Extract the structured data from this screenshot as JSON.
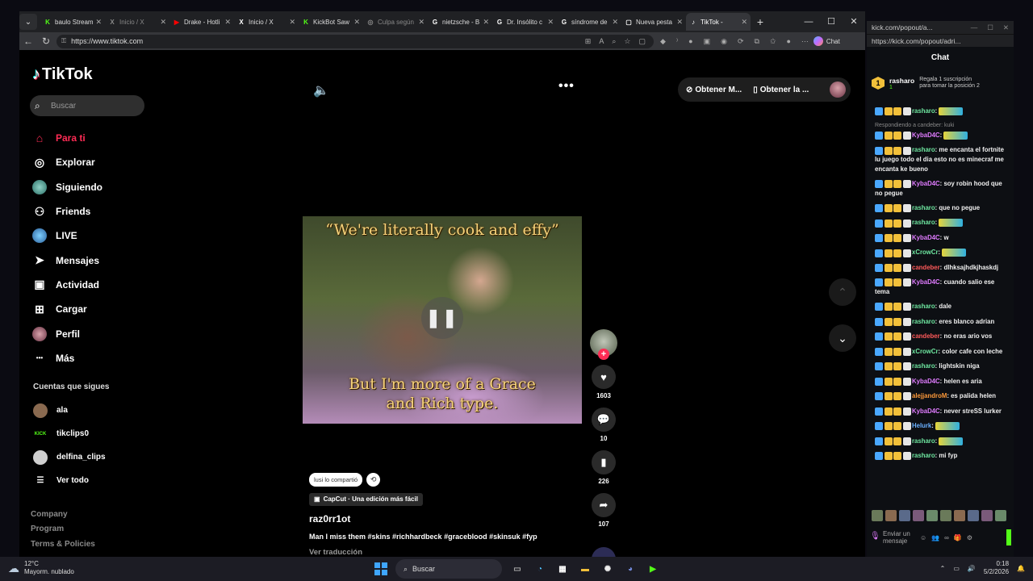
{
  "browser": {
    "tabs": [
      {
        "label": "baulo Stream",
        "icon": "kick-icon",
        "color": "#53fc18",
        "dim": false
      },
      {
        "label": "Inicio / X",
        "icon": "x-icon",
        "color": "#888888",
        "dim": true
      },
      {
        "label": "Drake - Hotli",
        "icon": "youtube-icon",
        "color": "#ff0000",
        "dim": false
      },
      {
        "label": "Inicio / X",
        "icon": "x-icon",
        "color": "#ffffff",
        "dim": false
      },
      {
        "label": "KickBot Saw",
        "icon": "kick-icon",
        "color": "#53fc18",
        "dim": false
      },
      {
        "label": "Culpa según",
        "icon": "globe-icon",
        "color": "#888888",
        "dim": true
      },
      {
        "label": "nietzsche - B",
        "icon": "google-icon",
        "color": "#ffffff",
        "dim": false
      },
      {
        "label": "Dr. Insólito c",
        "icon": "google-icon",
        "color": "#ffffff",
        "dim": false
      },
      {
        "label": "síndrome de",
        "icon": "google-icon",
        "color": "#ffffff",
        "dim": false
      },
      {
        "label": "Nueva pesta",
        "icon": "new-tab-icon",
        "color": "#ffffff",
        "dim": false
      },
      {
        "label": "TikTok -",
        "icon": "tiktok-icon",
        "color": "#ffffff",
        "dim": false,
        "active": true
      }
    ],
    "url": "https://www.tiktok.com",
    "chat_label": "Chat"
  },
  "tiktok": {
    "logo": "TikTok",
    "search_placeholder": "Buscar",
    "nav": [
      {
        "label": "Para ti",
        "icon": "home-icon",
        "active": true
      },
      {
        "label": "Explorar",
        "icon": "compass-icon"
      },
      {
        "label": "Siguiendo",
        "icon": "following-avatar-icon"
      },
      {
        "label": "Friends",
        "icon": "friends-icon"
      },
      {
        "label": "LIVE",
        "icon": "live-avatar-icon"
      },
      {
        "label": "Mensajes",
        "icon": "send-icon"
      },
      {
        "label": "Actividad",
        "icon": "activity-icon"
      },
      {
        "label": "Cargar",
        "icon": "upload-icon"
      },
      {
        "label": "Perfil",
        "icon": "profile-avatar-icon"
      },
      {
        "label": "Más",
        "icon": "more-icon"
      }
    ],
    "following_title": "Cuentas que sigues",
    "following": [
      {
        "name": "ala",
        "avatar_color": "#8a6a50",
        "badge": ""
      },
      {
        "name": "tikclips0",
        "avatar_color": "#000000",
        "badge": "KICK"
      },
      {
        "name": "delfina_clips",
        "avatar_color": "#cfcfcf",
        "badge": ""
      }
    ],
    "see_all": "Ver todo",
    "footer": [
      "Company",
      "Program",
      "Terms & Policies"
    ],
    "top_buttons": [
      "Obtener M...",
      "Obtener la ..."
    ],
    "video": {
      "caption_top": "“We're literally cook and effy”",
      "caption_bottom": "But I'm more of a Grace and Rich type.",
      "likes": "1603",
      "comments": "10",
      "saves": "226",
      "shares": "107",
      "shared_by": "lusi lo compartió",
      "capcut": "CapCut · Una edición más fácil",
      "username": "raz0rr1ot",
      "description": "Man I miss them #skins #richhardbeck #graceblood #skinsuk #fyp",
      "translate": "Ver traducción",
      "progress": 0.27
    }
  },
  "kick": {
    "title": "kick.com/popout/a...",
    "url": "https://kick.com/popout/adri...",
    "header": "Chat",
    "pinned": {
      "user": "rasharo",
      "count": "1",
      "text": "Regala 1 suscripción para tomar la posición 2"
    },
    "messages": [
      {
        "user": "rasharo",
        "color": "#6ee7a0",
        "text": "",
        "emote": true
      },
      {
        "reply": "Respondiendo a candeber: kuki",
        "user": "KybaD4C",
        "color": "#e07cff",
        "text": "",
        "emote": true
      },
      {
        "user": "rasharo",
        "color": "#6ee7a0",
        "text": "me encanta el fortnite lu juego todo el dia esto no es minecraf me encanta ke bueno"
      },
      {
        "user": "KybaD4C",
        "color": "#e07cff",
        "text": "soy robin hood que no pegue"
      },
      {
        "user": "rasharo",
        "color": "#6ee7a0",
        "text": "que no pegue"
      },
      {
        "user": "rasharo",
        "color": "#6ee7a0",
        "text": "",
        "emote": true
      },
      {
        "user": "KybaD4C",
        "color": "#e07cff",
        "text": "w"
      },
      {
        "user": "xCrowCr",
        "color": "#6ee7a0",
        "text": "",
        "emote": true
      },
      {
        "user": "candeber",
        "color": "#ff5a5a",
        "text": "dlhksajhdkjhaskdj"
      },
      {
        "user": "KybaD4C",
        "color": "#e07cff",
        "text": "cuando salio ese tema"
      },
      {
        "user": "rasharo",
        "color": "#6ee7a0",
        "text": "dale"
      },
      {
        "user": "rasharo",
        "color": "#6ee7a0",
        "text": "eres blanco adrian"
      },
      {
        "user": "candeber",
        "color": "#ff5a5a",
        "text": "no eras ario vos"
      },
      {
        "user": "xCrowCr",
        "color": "#6ee7a0",
        "text": "color cafe con leche"
      },
      {
        "user": "rasharo",
        "color": "#6ee7a0",
        "text": "lightskin niga"
      },
      {
        "user": "KybaD4C",
        "color": "#e07cff",
        "text": "helen es aria"
      },
      {
        "user": "alejjandroM",
        "color": "#ff9a3a",
        "text": "es palida helen"
      },
      {
        "user": "KybaD4C",
        "color": "#e07cff",
        "text": "never streSS lurker"
      },
      {
        "user": "Helurk",
        "color": "#6ab0ff",
        "text": "",
        "emote": true
      },
      {
        "user": "rasharo",
        "color": "#6ee7a0",
        "text": "",
        "emote": true
      },
      {
        "user": "rasharo",
        "color": "#6ee7a0",
        "text": "mi fyp"
      }
    ],
    "input_placeholder": "Enviar un mensaje"
  },
  "taskbar": {
    "temp": "12°C",
    "weather": "Mayorm. nublado",
    "search": "Buscar",
    "time": "0:18",
    "date": "5/2/2026"
  }
}
